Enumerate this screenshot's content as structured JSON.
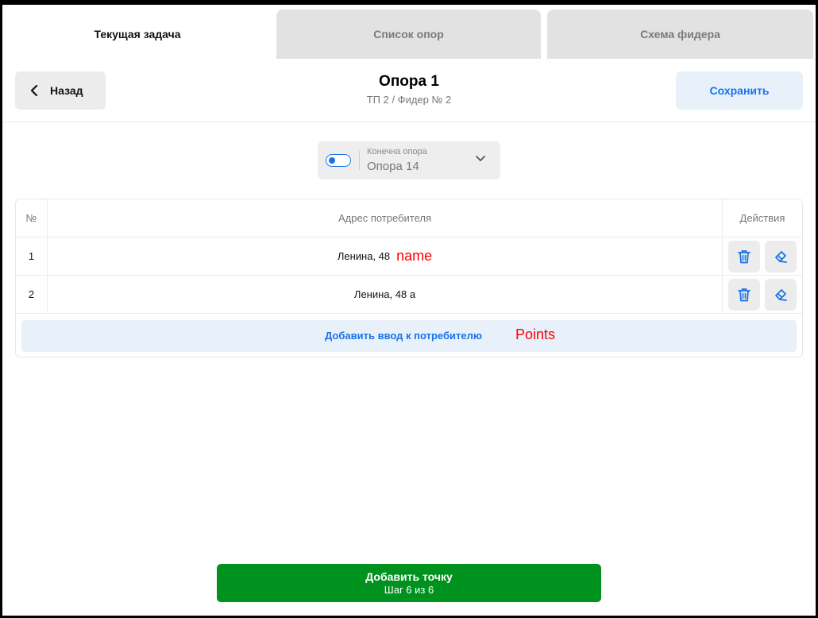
{
  "tabs": [
    {
      "label": "Текущая задача",
      "active": true
    },
    {
      "label": "Список опор",
      "active": false
    },
    {
      "label": "Схема фидера",
      "active": false
    }
  ],
  "header": {
    "back_label": "Назад",
    "title": "Опора 1",
    "subtitle": "ТП 2 / Фидер № 2",
    "save_label": "Сохранить"
  },
  "selector": {
    "toggle_on": true,
    "label": "Конечна опора",
    "value": "Опора 14"
  },
  "table": {
    "columns": [
      "№",
      "Адрес потребителя",
      "Действия"
    ],
    "rows": [
      {
        "num": "1",
        "address": "Ленина, 48",
        "note": "name"
      },
      {
        "num": "2",
        "address": "Ленина, 48 а",
        "note": ""
      }
    ],
    "add_label": "Добавить ввод к потребителю",
    "add_note": "Points"
  },
  "footer": {
    "add_point_label": "Добавить точку",
    "step_label": "Шаг 6 из 6"
  },
  "colors": {
    "accent": "#1a73e8",
    "primary_green": "#00921f",
    "annotation_red": "#ff0000"
  },
  "icons": {
    "back": "chevron-left-icon",
    "dropdown": "chevron-down-icon",
    "delete": "trash-icon",
    "edit": "pencil-icon"
  }
}
